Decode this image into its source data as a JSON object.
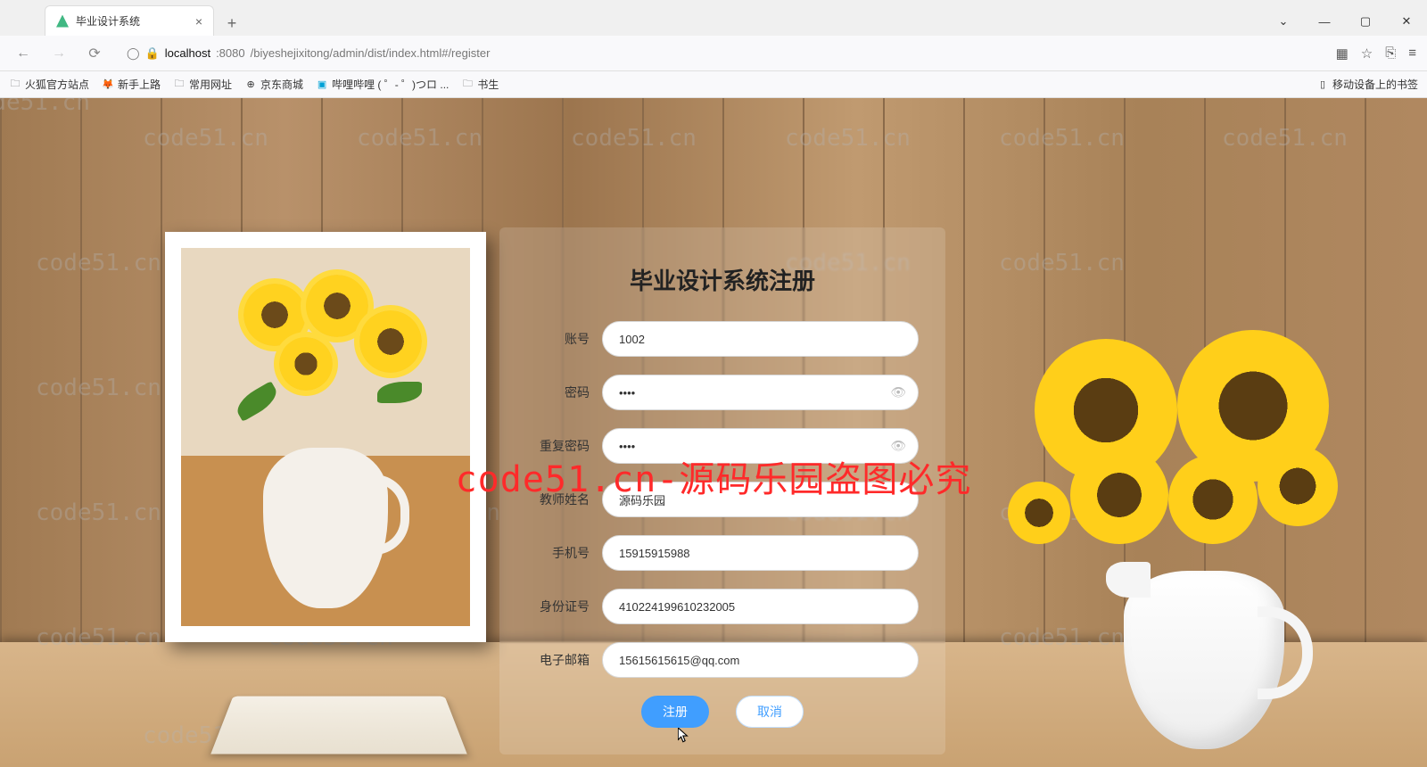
{
  "browser": {
    "tab_title": "毕业设计系统",
    "url_host": "localhost",
    "url_port": ":8080",
    "url_path": "/biyeshejixitong/admin/dist/index.html#/register"
  },
  "bookmarks": {
    "b1": "火狐官方站点",
    "b2": "新手上路",
    "b3": "常用网址",
    "b4": "京东商城",
    "b5": "哔哩哔哩 (  ゜- ゜)つロ ...",
    "b6": "书生",
    "right": "移动设备上的书签"
  },
  "form": {
    "title": "毕业设计系统注册",
    "labels": {
      "account": "账号",
      "password": "密码",
      "repeat": "重复密码",
      "name": "教师姓名",
      "phone": "手机号",
      "idcard": "身份证号",
      "email": "电子邮箱"
    },
    "values": {
      "account": "1002",
      "password": "••••",
      "repeat": "••••",
      "name": "源码乐园",
      "phone": "15915915988",
      "idcard": "410224199610232005",
      "email": "15615615615@qq.com"
    },
    "register_btn": "注册",
    "cancel_btn": "取消"
  },
  "watermark_text": "code51.cn",
  "overlay_text": "code51.cn-源码乐园盗图必究"
}
